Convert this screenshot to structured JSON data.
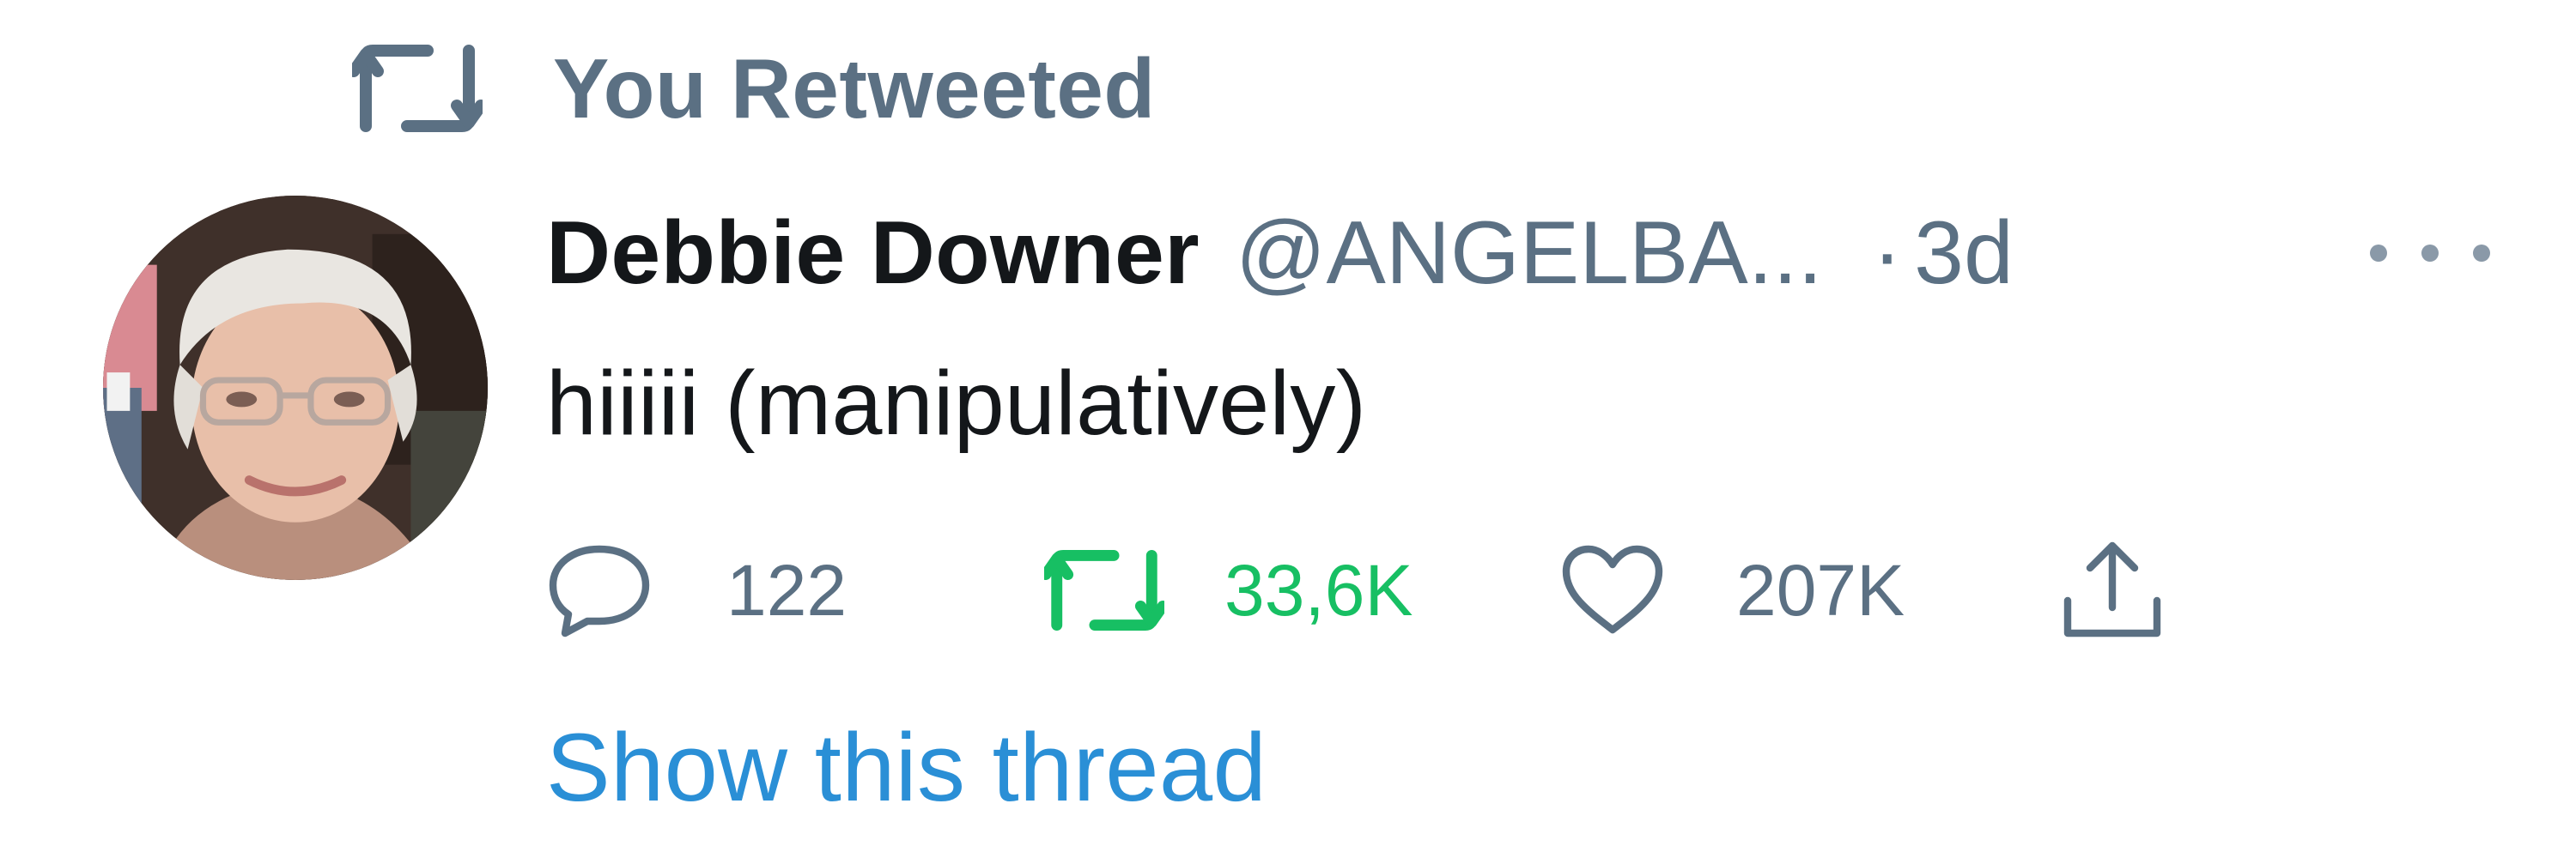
{
  "retweet_context": {
    "icon": "retweet-icon",
    "text": "You Retweeted"
  },
  "author": {
    "avatar": "profile-photo",
    "name": "Debbie Downer",
    "handle": "@ANGELBA...",
    "separator": "·",
    "time": "3d"
  },
  "tweet": {
    "text": "hiiiii (manipulatively)"
  },
  "actions": {
    "reply": {
      "icon": "reply-icon",
      "count": "122"
    },
    "retweet": {
      "icon": "retweet-icon",
      "count": "33,6K",
      "active": true
    },
    "like": {
      "icon": "heart-icon",
      "count": "207K"
    },
    "share": {
      "icon": "share-icon"
    }
  },
  "more": {
    "icon": "more-options-icon"
  },
  "show_thread": "Show this thread",
  "colors": {
    "text_primary": "#14171a",
    "text_secondary": "#5b7083",
    "retweet_active": "#17bf63",
    "link": "#2a8fd6"
  }
}
